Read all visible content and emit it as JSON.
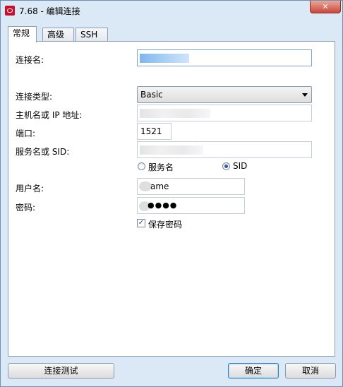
{
  "window": {
    "title": "7.68 - 编辑连接",
    "close_glyph": "✕"
  },
  "tabs": [
    {
      "label": "常规",
      "active": true
    },
    {
      "label": "高级",
      "active": false
    },
    {
      "label": "SSH",
      "active": false
    }
  ],
  "form": {
    "connection_name_label": "连接名:",
    "connection_type_label": "连接类型:",
    "connection_type_value": "Basic",
    "host_label": "主机名或 IP 地址:",
    "port_label": "端口:",
    "port_value": "1521",
    "service_label": "服务名或 SID:",
    "radio_service_name": "服务名",
    "radio_sid": "SID",
    "radio_selected": "SID",
    "username_label": "用户名:",
    "username_value": "ame",
    "password_label": "密码:",
    "password_value": "●●●●",
    "save_password_label": "保存密码",
    "save_password_checked": true
  },
  "buttons": {
    "test": "连接测试",
    "ok": "确定",
    "cancel": "取消"
  },
  "colors": {
    "window_bg": "#dbe8f6",
    "accent": "#3c7fb1",
    "close": "#c9483a"
  }
}
